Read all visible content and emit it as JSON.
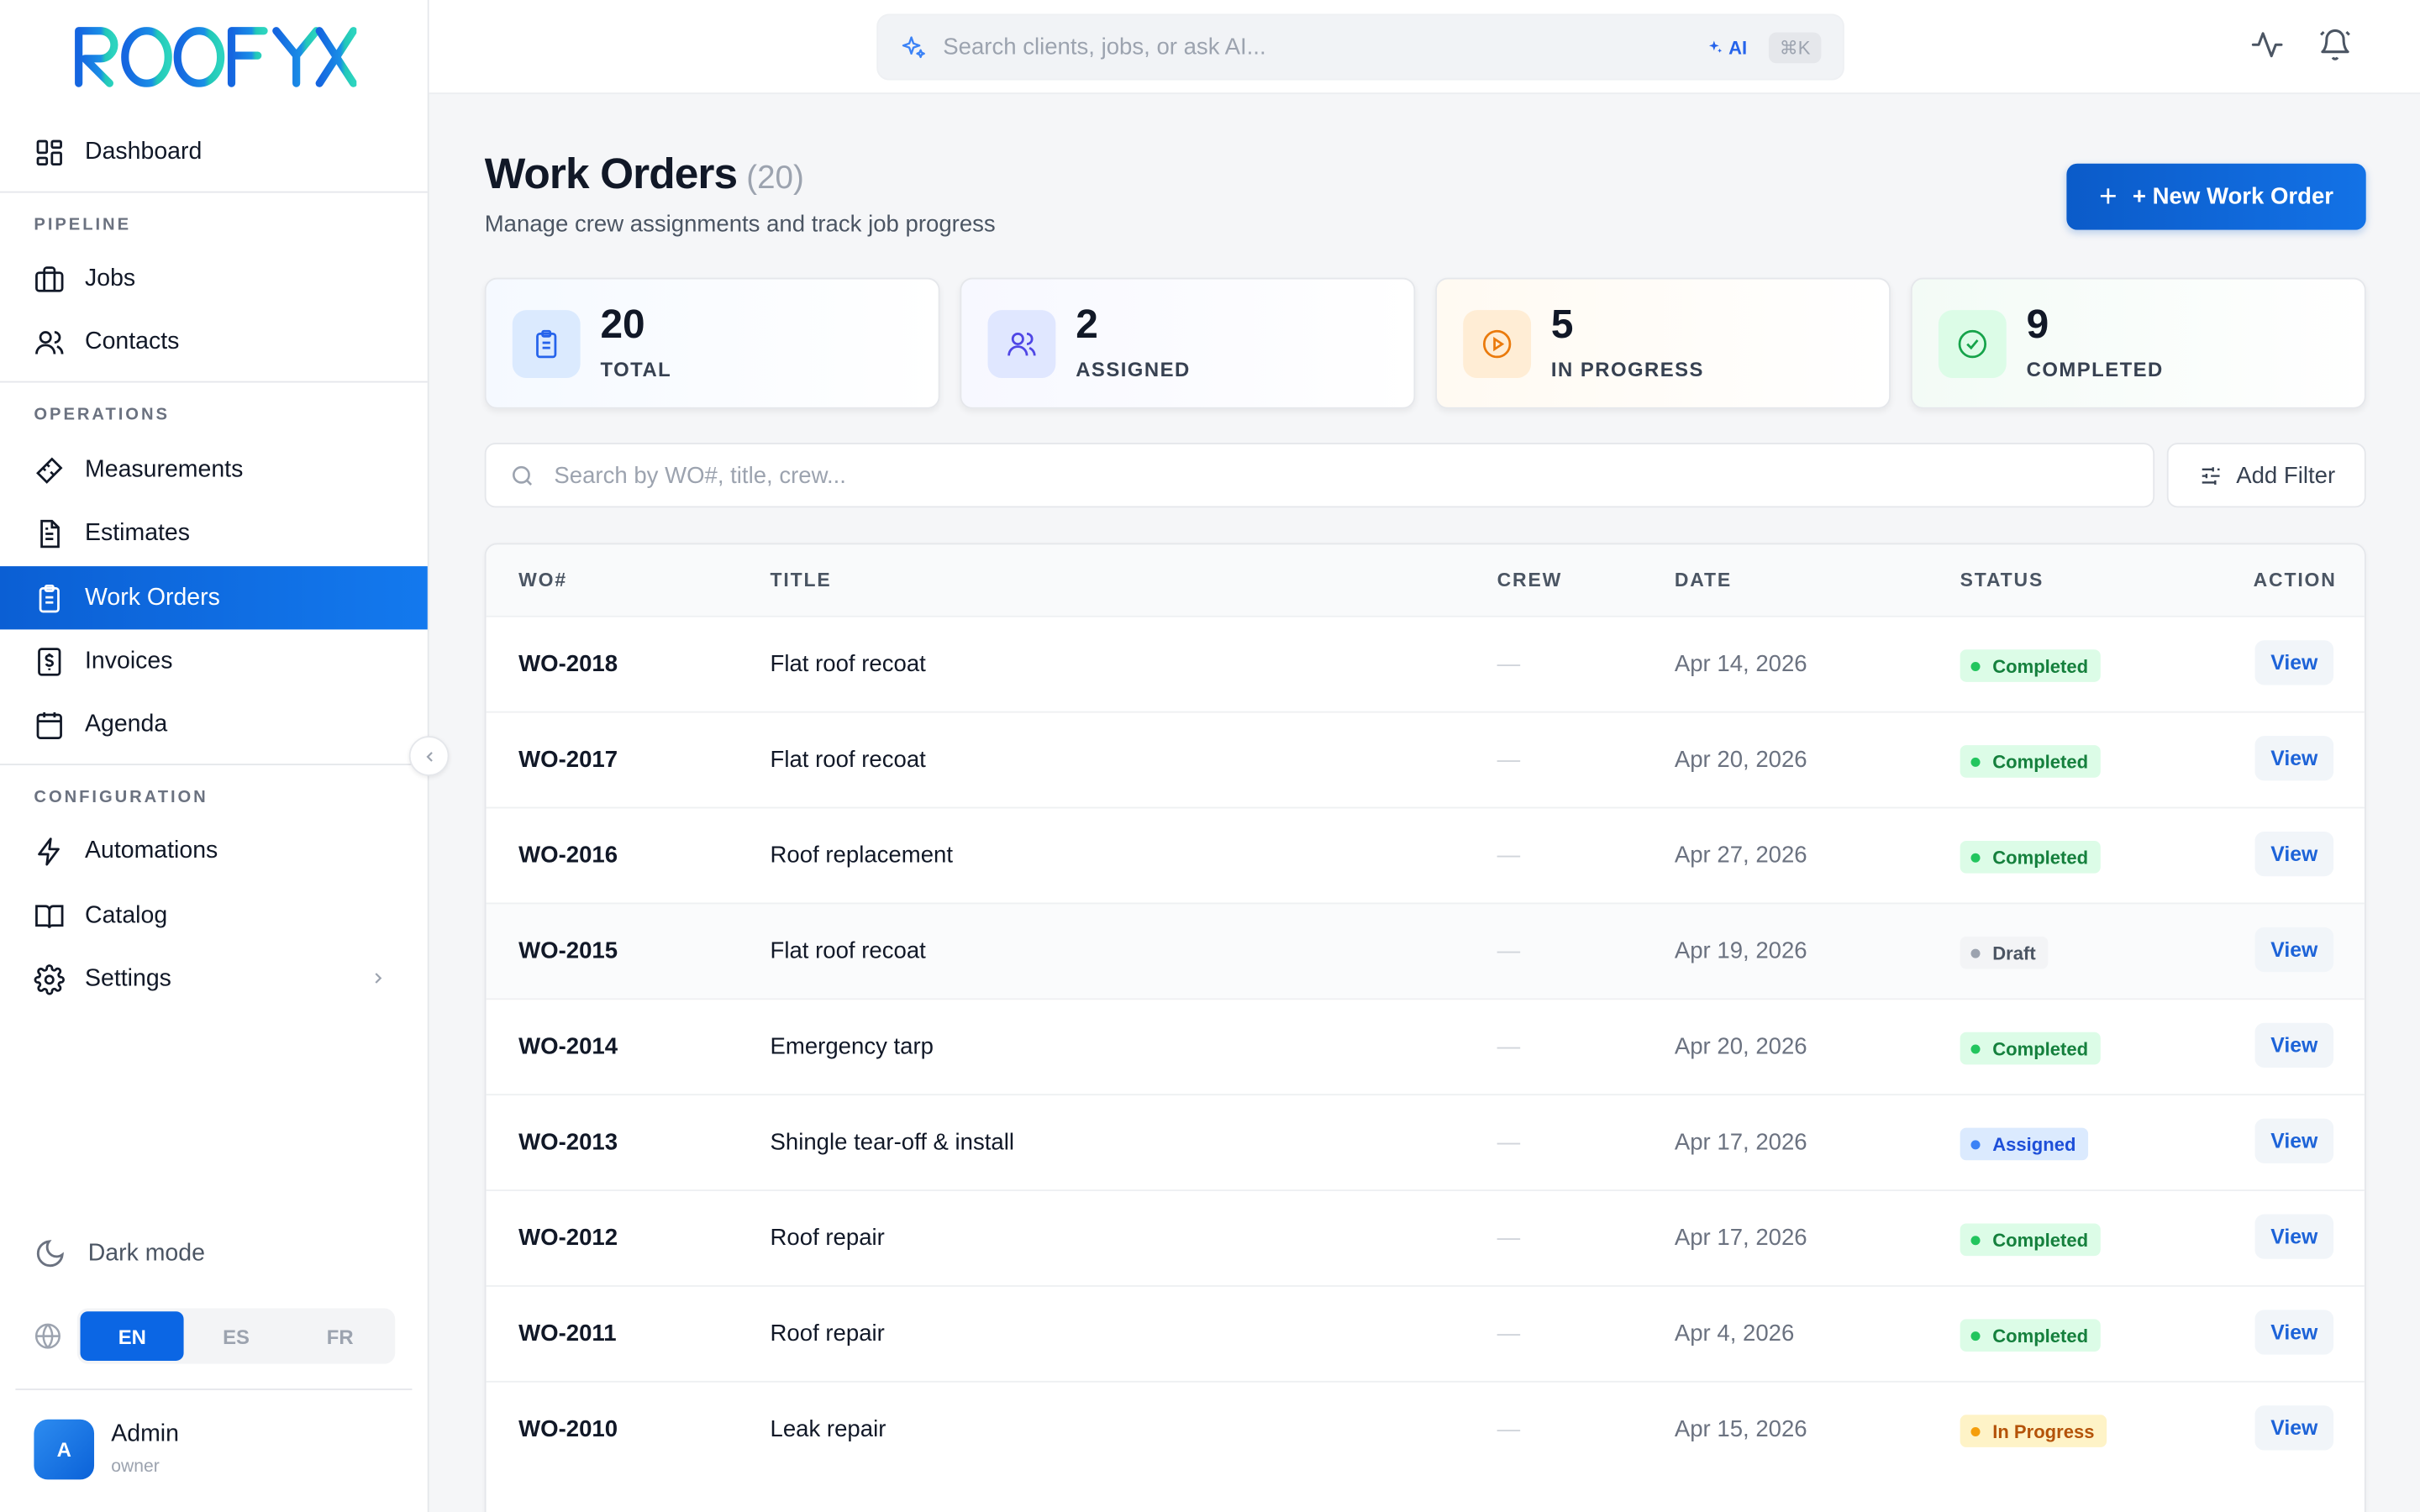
{
  "app": {
    "brand": "ROOFYX"
  },
  "sidebar": {
    "dashboard": "Dashboard",
    "sections": {
      "pipeline": "PIPELINE",
      "operations": "OPERATIONS",
      "configuration": "CONFIGURATION"
    },
    "items": {
      "jobs": "Jobs",
      "contacts": "Contacts",
      "measurements": "Measurements",
      "estimates": "Estimates",
      "work_orders": "Work Orders",
      "invoices": "Invoices",
      "agenda": "Agenda",
      "automations": "Automations",
      "catalog": "Catalog",
      "settings": "Settings"
    },
    "active_item": "Work Orders",
    "dark_mode": "Dark mode",
    "languages": [
      "EN",
      "ES",
      "FR"
    ],
    "active_language": "EN",
    "user": {
      "initial": "A",
      "name": "Admin",
      "role": "owner"
    }
  },
  "topbar": {
    "search_placeholder": "Search clients, jobs, or ask AI...",
    "ai_label": "AI",
    "shortcut": "⌘K"
  },
  "page": {
    "title": "Work Orders",
    "count": "(20)",
    "subtitle": "Manage crew assignments and track job progress",
    "new_button": "+ New Work Order"
  },
  "stats": {
    "total": {
      "value": "20",
      "label": "TOTAL"
    },
    "assigned": {
      "value": "2",
      "label": "ASSIGNED"
    },
    "in_progress": {
      "value": "5",
      "label": "IN PROGRESS"
    },
    "completed": {
      "value": "9",
      "label": "COMPLETED"
    }
  },
  "filters": {
    "search_placeholder": "Search by WO#, title, crew...",
    "add_filter": "Add Filter"
  },
  "table": {
    "columns": {
      "wo": "WO#",
      "title": "TITLE",
      "crew": "CREW",
      "date": "DATE",
      "status": "STATUS",
      "action": "ACTION"
    },
    "rows": [
      {
        "wo": "WO-2018",
        "title": "Flat roof recoat",
        "crew": "—",
        "date": "Apr 14, 2026",
        "status": "Completed",
        "action": "View"
      },
      {
        "wo": "WO-2017",
        "title": "Flat roof recoat",
        "crew": "—",
        "date": "Apr 20, 2026",
        "status": "Completed",
        "action": "View"
      },
      {
        "wo": "WO-2016",
        "title": "Roof replacement",
        "crew": "—",
        "date": "Apr 27, 2026",
        "status": "Completed",
        "action": "View"
      },
      {
        "wo": "WO-2015",
        "title": "Flat roof recoat",
        "crew": "—",
        "date": "Apr 19, 2026",
        "status": "Draft",
        "action": "View"
      },
      {
        "wo": "WO-2014",
        "title": "Emergency tarp",
        "crew": "—",
        "date": "Apr 20, 2026",
        "status": "Completed",
        "action": "View"
      },
      {
        "wo": "WO-2013",
        "title": "Shingle tear-off & install",
        "crew": "—",
        "date": "Apr 17, 2026",
        "status": "Assigned",
        "action": "View"
      },
      {
        "wo": "WO-2012",
        "title": "Roof repair",
        "crew": "—",
        "date": "Apr 17, 2026",
        "status": "Completed",
        "action": "View"
      },
      {
        "wo": "WO-2011",
        "title": "Roof repair",
        "crew": "—",
        "date": "Apr 4, 2026",
        "status": "Completed",
        "action": "View"
      },
      {
        "wo": "WO-2010",
        "title": "Leak repair",
        "crew": "—",
        "date": "Apr 15, 2026",
        "status": "In Progress",
        "action": "View"
      }
    ]
  },
  "status_colors": {
    "Completed": {
      "bg": "#dcfce7",
      "fg": "#15803d",
      "dot": "#22c55e"
    },
    "Draft": {
      "bg": "#f3f4f6",
      "fg": "#4b5563",
      "dot": "#9ca3af"
    },
    "Assigned": {
      "bg": "#dbeafe",
      "fg": "#1d4ed8",
      "dot": "#3b82f6"
    },
    "In Progress": {
      "bg": "#fef3c7",
      "fg": "#b45309",
      "dot": "#f59e0b"
    }
  }
}
